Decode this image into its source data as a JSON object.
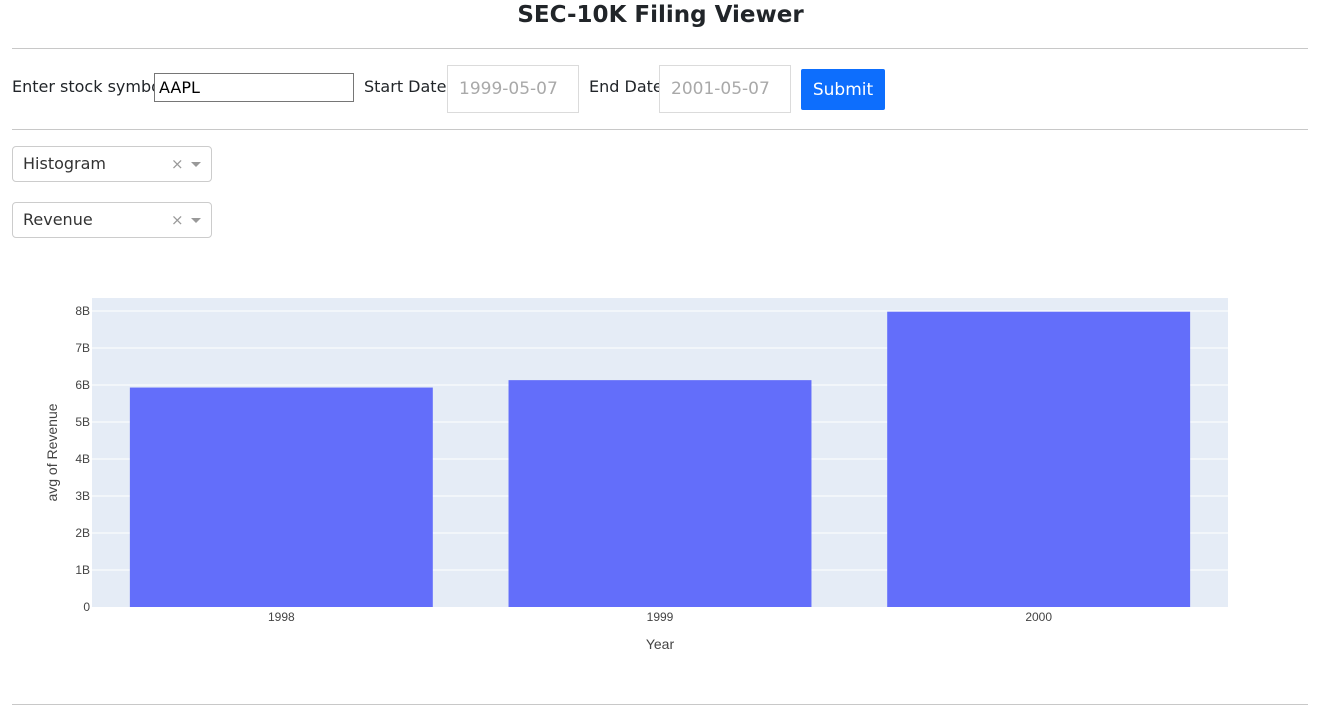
{
  "page": {
    "title": "SEC-10K Filing Viewer"
  },
  "form": {
    "symbol_label": "Enter stock symbol:",
    "symbol_value": "AAPL",
    "start_label": "Start Date:",
    "start_placeholder": "1999-05-07",
    "end_label": "End Date:",
    "end_placeholder": "2001-05-07",
    "submit_label": "Submit"
  },
  "controls": {
    "chart_type": {
      "value": "Histogram",
      "clear_glyph": "×"
    },
    "metric": {
      "value": "Revenue",
      "clear_glyph": "×"
    }
  },
  "colors": {
    "bar": "#636efa",
    "plot_bg": "#e5ecf6",
    "button": "#0d6efd"
  },
  "chart_data": {
    "type": "bar",
    "categories": [
      "1998",
      "1999",
      "2000"
    ],
    "values": [
      5930000000,
      6130000000,
      7980000000
    ],
    "xlabel": "Year",
    "ylabel": "avg of Revenue",
    "ylim": [
      0,
      8350000000
    ],
    "yticks": [
      0,
      1000000000,
      2000000000,
      3000000000,
      4000000000,
      5000000000,
      6000000000,
      7000000000,
      8000000000
    ],
    "ytick_labels": [
      "0",
      "1B",
      "2B",
      "3B",
      "4B",
      "5B",
      "6B",
      "7B",
      "8B"
    ],
    "grid": true,
    "legend": "none"
  }
}
